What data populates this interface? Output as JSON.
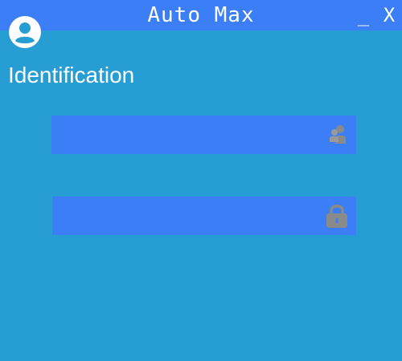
{
  "window": {
    "title": "Auto Max",
    "minimize_label": "_",
    "close_label": "X"
  },
  "header": {
    "icon": "user-circle-icon",
    "heading": "Identification"
  },
  "form": {
    "username": {
      "value": "",
      "placeholder": "",
      "icon": "users-icon"
    },
    "password": {
      "value": "",
      "placeholder": "",
      "icon": "lock-icon"
    }
  },
  "colors": {
    "background": "#269ed4",
    "titlebar": "#3b7ef5",
    "field": "#3b7ef5",
    "icon_gray": "#8a8a8a",
    "text": "#ffffff"
  }
}
